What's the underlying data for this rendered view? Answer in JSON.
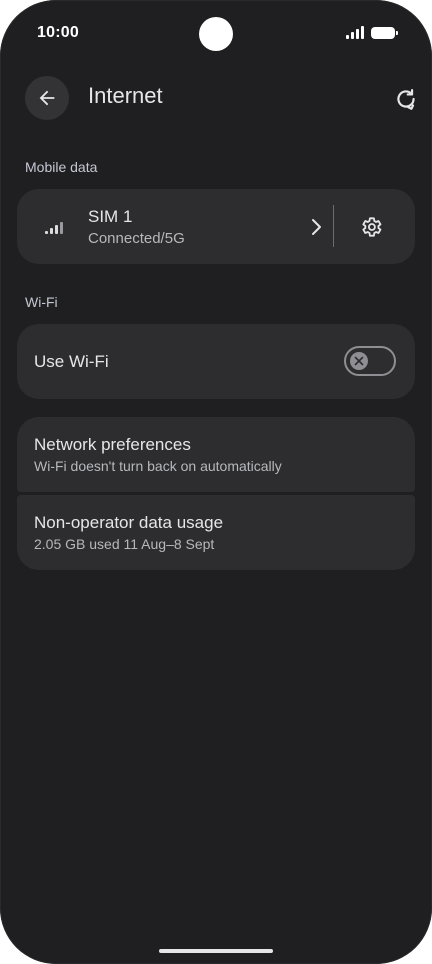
{
  "status_bar": {
    "time": "10:00"
  },
  "app_bar": {
    "title": "Internet"
  },
  "mobile_data": {
    "header": "Mobile data",
    "sim": {
      "title": "SIM 1",
      "subtitle": "Connected/5G"
    }
  },
  "wifi": {
    "header": "Wi-Fi",
    "use_wifi": {
      "title": "Use Wi-Fi",
      "enabled": false
    }
  },
  "options": [
    {
      "title": "Network preferences",
      "subtitle": "Wi-Fi doesn't turn back on automatically"
    },
    {
      "title": "Non-operator data usage",
      "subtitle": "2.05 GB used 11 Aug–8 Sept"
    }
  ],
  "icons": {
    "back": "arrow-back-icon",
    "refresh": "refresh-icon",
    "signal": "signal-bars-icon",
    "chevron": "chevron-right-icon",
    "settings": "gear-icon",
    "toggle_off": "close-icon"
  },
  "colors": {
    "background": "#1f1f21",
    "card": "#2d2d2f",
    "text_primary": "#e6e6e8",
    "text_secondary": "#b7b8bd",
    "section_header": "#c5c7d3"
  }
}
